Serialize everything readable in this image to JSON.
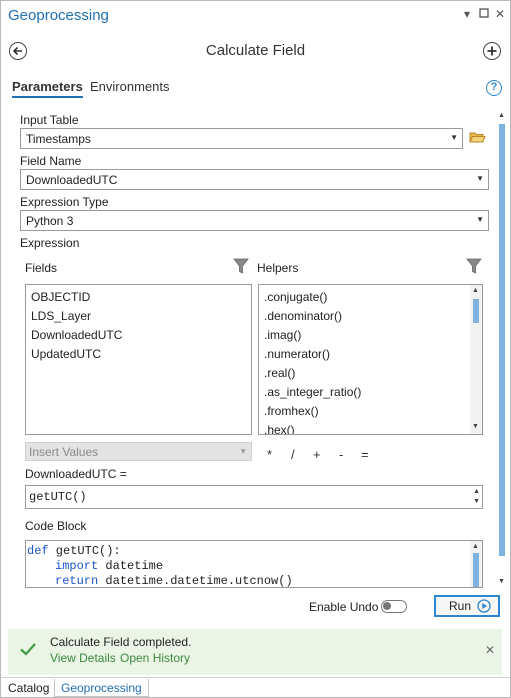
{
  "pane": {
    "title": "Geoprocessing",
    "window_controls": {
      "menu": "▾",
      "pin": "✕"
    }
  },
  "header": {
    "title": "Calculate Field",
    "back_icon": "back-arrow-icon",
    "add_icon": "add-icon"
  },
  "tabs": [
    {
      "label": "Parameters",
      "active": true
    },
    {
      "label": "Environments",
      "active": false
    }
  ],
  "help_glyph": "?",
  "input_table": {
    "label": "Input Table",
    "value": "Timestamps"
  },
  "field_name": {
    "label": "Field Name",
    "value": "DownloadedUTC"
  },
  "expression_type": {
    "label": "Expression Type",
    "value": "Python 3"
  },
  "expression": {
    "label": "Expression",
    "fields_label": "Fields",
    "helpers_label": "Helpers",
    "fields": [
      "OBJECTID",
      "LDS_Layer",
      "DownloadedUTC",
      "UpdatedUTC"
    ],
    "helpers": [
      ".conjugate()",
      ".denominator()",
      ".imag()",
      ".numerator()",
      ".real()",
      ".as_integer_ratio()",
      ".fromhex()",
      ".hex()"
    ],
    "insert_values_placeholder": "Insert Values",
    "operators": [
      "*",
      "/",
      "+",
      "-",
      "="
    ]
  },
  "assignment": {
    "label": "DownloadedUTC =",
    "value": "getUTC()"
  },
  "code_block": {
    "label": "Code Block",
    "line1_kw": "def",
    "line1_rest": " getUTC():",
    "line2_kw": "import",
    "line2_rest": " datetime",
    "line3_kw": "return",
    "line3_rest": " datetime.datetime.utcnow()"
  },
  "footer": {
    "enable_undo_label": "Enable Undo",
    "run_label": "Run"
  },
  "message": {
    "text": "Calculate Field completed.",
    "view_details": "View Details",
    "open_history": "Open History"
  },
  "bottom_tabs": [
    {
      "label": "Catalog",
      "active": false
    },
    {
      "label": "Geoprocessing",
      "active": true
    }
  ],
  "colors": {
    "accent": "#1f6fb5",
    "keyword": "#1a55c8",
    "success": "#3d9a3d",
    "message_bg": "#eaf5e6"
  }
}
